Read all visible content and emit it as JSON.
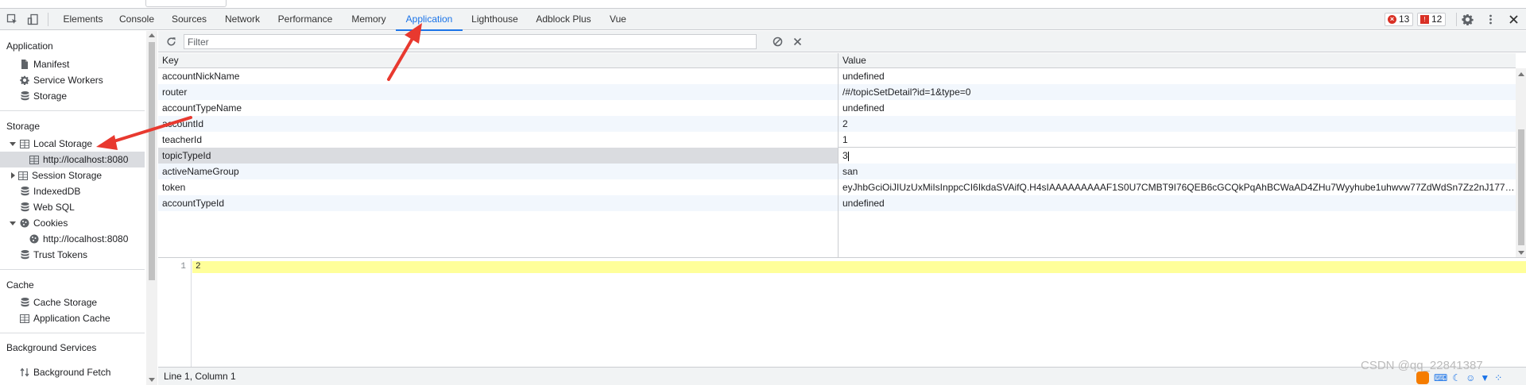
{
  "devtools": {
    "tabs": [
      {
        "label": "Elements"
      },
      {
        "label": "Console"
      },
      {
        "label": "Sources"
      },
      {
        "label": "Network"
      },
      {
        "label": "Performance"
      },
      {
        "label": "Memory"
      },
      {
        "label": "Application",
        "active": true
      },
      {
        "label": "Lighthouse"
      },
      {
        "label": "Adblock Plus"
      },
      {
        "label": "Vue"
      }
    ],
    "error_count": "13",
    "issue_count": "12",
    "accent_color": "#1a73e8"
  },
  "sidebar": {
    "sections": {
      "application": {
        "title": "Application",
        "items": [
          {
            "label": "Manifest",
            "icon": "document-icon"
          },
          {
            "label": "Service Workers",
            "icon": "gear-icon"
          },
          {
            "label": "Storage",
            "icon": "database-icon"
          }
        ]
      },
      "storage": {
        "title": "Storage",
        "items": [
          {
            "label": "Local Storage",
            "icon": "grid-icon",
            "expanded": true
          },
          {
            "label": "http://localhost:8080",
            "icon": "grid-icon",
            "selected": true
          },
          {
            "label": "Session Storage",
            "icon": "grid-icon",
            "expanded": false
          },
          {
            "label": "IndexedDB",
            "icon": "database-icon"
          },
          {
            "label": "Web SQL",
            "icon": "database-icon"
          },
          {
            "label": "Cookies",
            "icon": "cookie-icon",
            "expanded": true
          },
          {
            "label": "http://localhost:8080",
            "icon": "cookie-icon"
          },
          {
            "label": "Trust Tokens",
            "icon": "database-icon"
          }
        ]
      },
      "cache": {
        "title": "Cache",
        "items": [
          {
            "label": "Cache Storage",
            "icon": "database-icon"
          },
          {
            "label": "Application Cache",
            "icon": "grid-icon"
          }
        ]
      },
      "background": {
        "title": "Background Services",
        "items": [
          {
            "label": "Background Fetch",
            "icon": "updown-arrows-icon"
          }
        ]
      }
    }
  },
  "storage_view": {
    "filter_placeholder": "Filter",
    "columns": {
      "key": "Key",
      "value": "Value"
    },
    "rows": [
      {
        "key": "accountNickName",
        "value": "undefined"
      },
      {
        "key": "router",
        "value": "/#/topicSetDetail?id=1&type=0"
      },
      {
        "key": "accountTypeName",
        "value": "undefined"
      },
      {
        "key": "accountId",
        "value": "2"
      },
      {
        "key": "teacherId",
        "value": "1"
      },
      {
        "key": "topicTypeId",
        "value": "3",
        "selected": true,
        "editing": true
      },
      {
        "key": "activeNameGroup",
        "value": "san"
      },
      {
        "key": "token",
        "value": "eyJhbGciOiJIUzUxMiIsInppcCI6IkdaSVAifQ.H4sIAAAAAAAAAF1S0U7CMBT9I76QEB6cGCQkPqAhBCWaAD4ZHu7Wyyhube1uhwvw77ZdWdSn7Zz2nJ177k4Mvz..."
      },
      {
        "key": "accountTypeId",
        "value": "undefined"
      }
    ],
    "editor": {
      "line_number": "1",
      "content": "2"
    },
    "status_text": "Line 1, Column 1"
  },
  "overlay": {
    "watermark": "CSDN @qq_22841387",
    "annotation_color": "#e8392f"
  }
}
